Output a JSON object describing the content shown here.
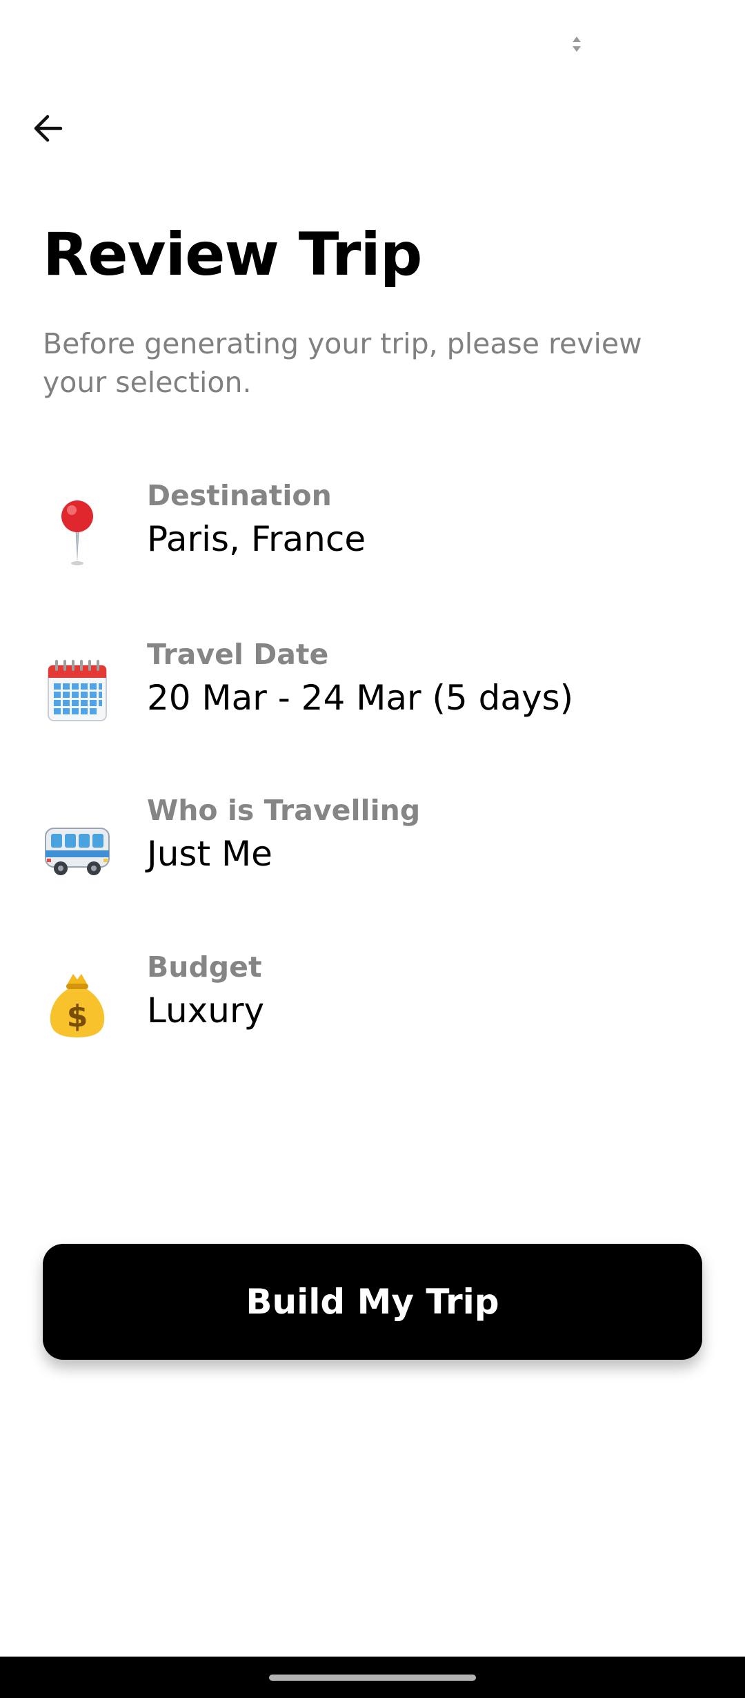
{
  "header": {
    "back_icon": "arrow-left-icon",
    "status_icon": "sort-arrows-icon"
  },
  "page": {
    "title": "Review Trip",
    "subtitle": "Before generating your trip, please review your selection."
  },
  "review_items": [
    {
      "icon": "map-pin-emoji-icon",
      "label": "Destination",
      "value": "Paris, France"
    },
    {
      "icon": "calendar-emoji-icon",
      "label": "Travel Date",
      "value": "20 Mar - 24 Mar (5 days)"
    },
    {
      "icon": "bus-emoji-icon",
      "label": "Who is Travelling",
      "value": "Just Me"
    },
    {
      "icon": "money-bag-emoji-icon",
      "label": "Budget",
      "value": "Luxury"
    }
  ],
  "build_button": {
    "label": "Build My Trip"
  },
  "colors": {
    "background": "#ffffff",
    "primary_text": "#000000",
    "secondary_text": "#808080",
    "button_background": "#000000",
    "button_text": "#ffffff"
  }
}
